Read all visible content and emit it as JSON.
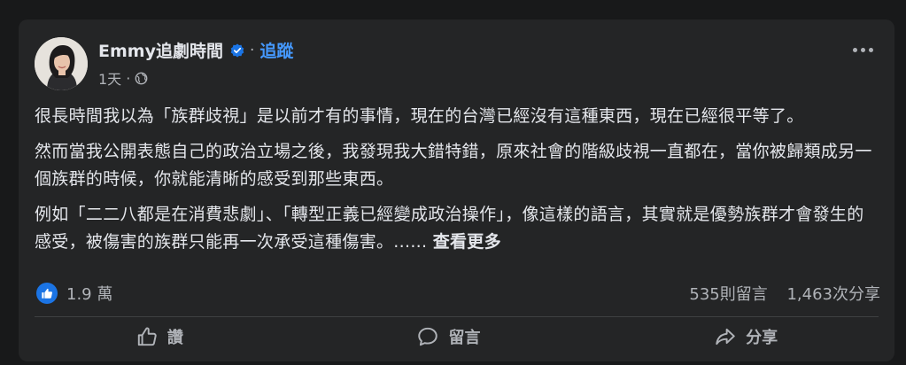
{
  "post": {
    "author": "Emmy追劇時間",
    "separator": "·",
    "follow_label": "追蹤",
    "time": "1天",
    "meta_separator": "·",
    "paragraphs": [
      "很長時間我以為「族群歧視」是以前才有的事情，現在的台灣已經沒有這種東西，現在已經很平等了。",
      "然而當我公開表態自己的政治立場之後，我發現我大錯特錯，原來社會的階級歧視一直都在，當你被歸類成另一個族群的時候，你就能清晰的感受到那些東西。",
      "例如「二二八都是在消費悲劇」、「轉型正義已經變成政治操作」，像這樣的語言，其實就是優勢族群才會發生的感受，被傷害的族群只能再一次承受這種傷害。......"
    ],
    "see_more": "查看更多"
  },
  "stats": {
    "likes": "1.9 萬",
    "comments": "535則留言",
    "shares": "1,463次分享"
  },
  "actions": {
    "like": "讚",
    "comment": "留言",
    "share": "分享"
  },
  "colors": {
    "background": "#18191a",
    "card": "#242526",
    "text_primary": "#e4e6eb",
    "text_secondary": "#b0b3b8",
    "accent": "#4599ff",
    "like_blue": "#1b74e4"
  }
}
